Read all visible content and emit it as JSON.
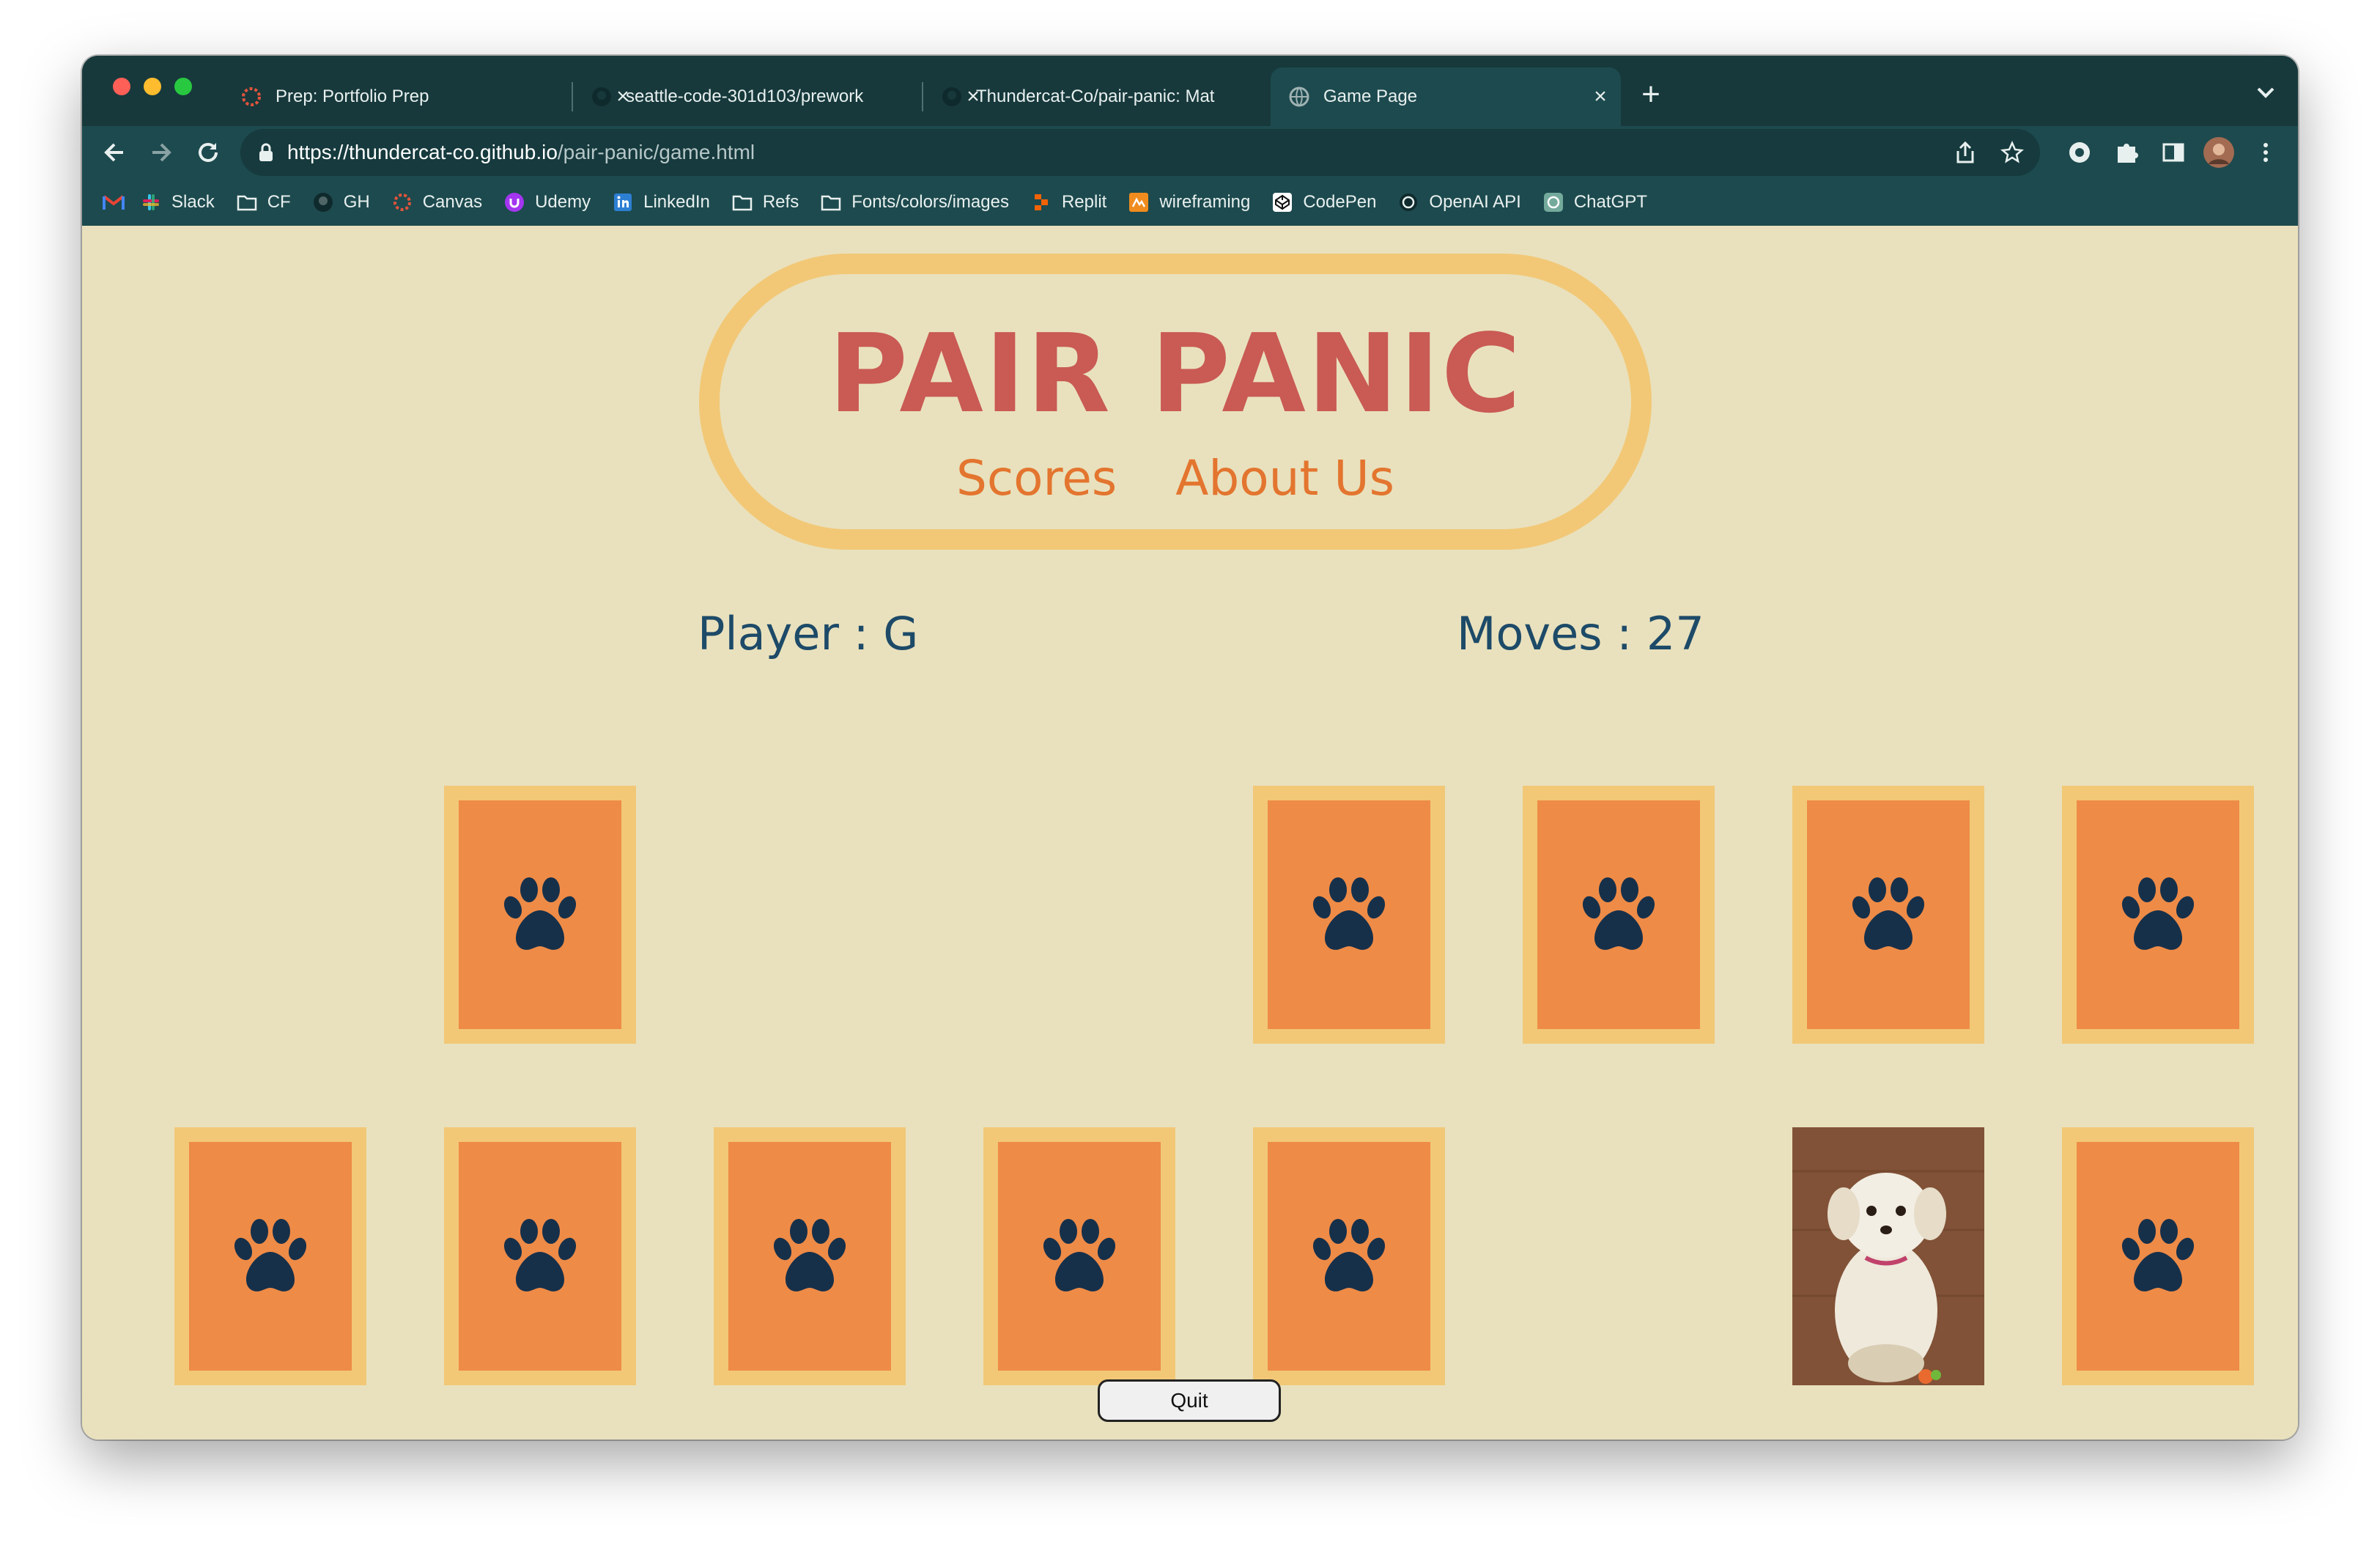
{
  "browser": {
    "tabs": [
      {
        "title": "Prep: Portfolio Prep",
        "active": false
      },
      {
        "title": "seattle-code-301d103/prework",
        "active": false
      },
      {
        "title": "Thundercat-Co/pair-panic: Mat",
        "active": false
      },
      {
        "title": "Game Page",
        "active": true
      }
    ],
    "url_host": "https://thundercat-co.github.io",
    "url_path": "/pair-panic/game.html",
    "bookmarks": [
      "Slack",
      "CF",
      "GH",
      "Canvas",
      "Udemy",
      "LinkedIn",
      "Refs",
      "Fonts/colors/images",
      "Replit",
      "wireframing",
      "CodePen",
      "OpenAI API",
      "ChatGPT"
    ]
  },
  "site": {
    "title": "PAIR PANIC",
    "nav": [
      "Scores",
      "About Us"
    ]
  },
  "game": {
    "player_label": "Player : G",
    "moves_label": "Moves : 27",
    "quit_label": "Quit",
    "cards": [
      {
        "row": 1,
        "col": 2,
        "state": "face-down"
      },
      {
        "row": 1,
        "col": 5,
        "state": "face-down"
      },
      {
        "row": 1,
        "col": 6,
        "state": "face-down"
      },
      {
        "row": 1,
        "col": 7,
        "state": "face-down"
      },
      {
        "row": 1,
        "col": 8,
        "state": "face-down"
      },
      {
        "row": 2,
        "col": 1,
        "state": "face-down"
      },
      {
        "row": 2,
        "col": 2,
        "state": "face-down"
      },
      {
        "row": 2,
        "col": 3,
        "state": "face-down"
      },
      {
        "row": 2,
        "col": 4,
        "state": "face-down"
      },
      {
        "row": 2,
        "col": 5,
        "state": "face-down"
      },
      {
        "row": 2,
        "col": 7,
        "state": "face-up-dog-photo"
      },
      {
        "row": 2,
        "col": 8,
        "state": "face-down"
      }
    ],
    "card_icon": "paw-icon"
  },
  "colors": {
    "page_bg": "#e9e1bd",
    "title": "#c95a54",
    "nav": "#e3752f",
    "stats": "#1d4a68",
    "card_frame": "#f2c877",
    "card_face": "#ee8b47",
    "paw": "#16304a",
    "browser_chrome": "#1d4a4e"
  }
}
